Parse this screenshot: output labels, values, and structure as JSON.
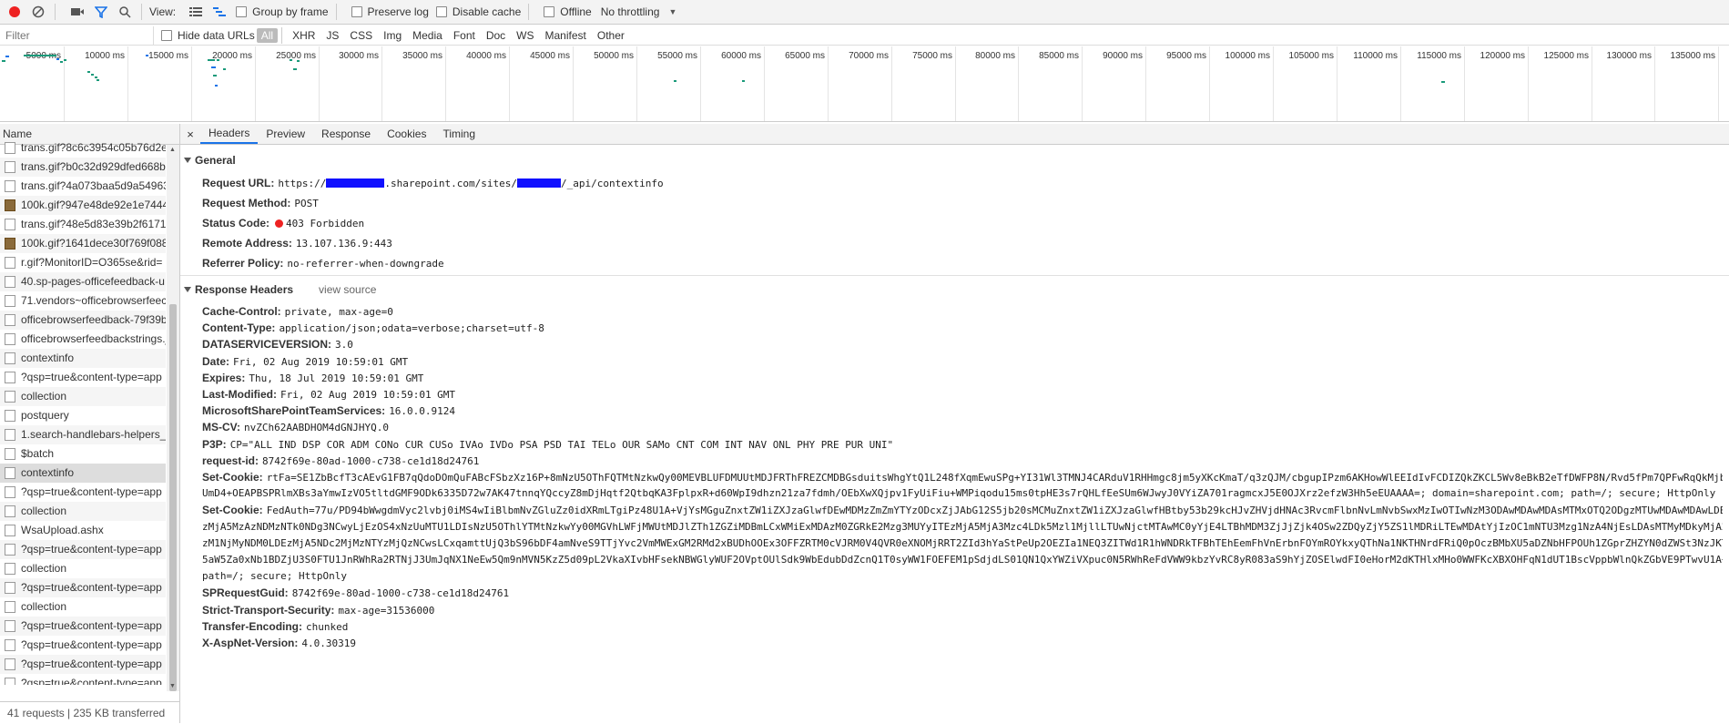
{
  "toolbar": {
    "view_label": "View:",
    "group_by_frame": "Group by frame",
    "preserve_log": "Preserve log",
    "disable_cache": "Disable cache",
    "offline": "Offline",
    "throttling": "No throttling"
  },
  "filterbar": {
    "placeholder": "Filter",
    "hide_data_urls": "Hide data URLs",
    "types": [
      "All",
      "XHR",
      "JS",
      "CSS",
      "Img",
      "Media",
      "Font",
      "Doc",
      "WS",
      "Manifest",
      "Other"
    ]
  },
  "timeline": {
    "ticks": [
      "5000 ms",
      "10000 ms",
      "15000 ms",
      "20000 ms",
      "25000 ms",
      "30000 ms",
      "35000 ms",
      "40000 ms",
      "45000 ms",
      "50000 ms",
      "55000 ms",
      "60000 ms",
      "65000 ms",
      "70000 ms",
      "75000 ms",
      "80000 ms",
      "85000 ms",
      "90000 ms",
      "95000 ms",
      "100000 ms",
      "105000 ms",
      "110000 ms",
      "115000 ms",
      "120000 ms",
      "125000 ms",
      "130000 ms",
      "135000 ms"
    ]
  },
  "name_panel": {
    "header": "Name",
    "rows": [
      "trans.gif?8c6c3954c05b76d2e",
      "trans.gif?b0c32d929dfed668b",
      "trans.gif?4a073baa5d9a54963",
      "100k.gif?947e48de92e1e7444",
      "trans.gif?48e5d83e39b2f61714",
      "100k.gif?1641dece30f769f088",
      "r.gif?MonitorID=O365se&rid=",
      "40.sp-pages-officefeedback-u",
      "71.vendors~officebrowserfeec",
      "officebrowserfeedback-79f39b",
      "officebrowserfeedbackstrings.j",
      "contextinfo",
      "?qsp=true&content-type=app",
      "collection",
      "postquery",
      "1.search-handlebars-helpers_3",
      "$batch",
      "contextinfo",
      "?qsp=true&content-type=app",
      "collection",
      "WsaUpload.ashx",
      "?qsp=true&content-type=app",
      "collection",
      "?qsp=true&content-type=app",
      "collection",
      "?qsp=true&content-type=app",
      "?qsp=true&content-type=app",
      "?qsp=true&content-type=app",
      "?qsp=true&content-type=app"
    ],
    "status": "41 requests  |  235 KB transferred"
  },
  "detail": {
    "close": "×",
    "tabs": [
      "Headers",
      "Preview",
      "Response",
      "Cookies",
      "Timing"
    ],
    "general_title": "General",
    "general": [
      {
        "k": "Request URL:",
        "v1": "https://",
        "v2": ".sharepoint.com/sites/",
        "v3": "/_api/contextinfo"
      },
      {
        "k": "Request Method:",
        "v": "POST"
      },
      {
        "k": "Status Code:",
        "v": "403 Forbidden"
      },
      {
        "k": "Remote Address:",
        "v": "13.107.136.9:443"
      },
      {
        "k": "Referrer Policy:",
        "v": "no-referrer-when-downgrade"
      }
    ],
    "response_title": "Response Headers",
    "view_source": "view source",
    "response": [
      {
        "k": "Cache-Control:",
        "v": "private, max-age=0"
      },
      {
        "k": "Content-Type:",
        "v": "application/json;odata=verbose;charset=utf-8"
      },
      {
        "k": "DATASERVICEVERSION:",
        "v": "3.0"
      },
      {
        "k": "Date:",
        "v": "Fri, 02 Aug 2019 10:59:01 GMT"
      },
      {
        "k": "Expires:",
        "v": "Thu, 18 Jul 2019 10:59:01 GMT"
      },
      {
        "k": "Last-Modified:",
        "v": "Fri, 02 Aug 2019 10:59:01 GMT"
      },
      {
        "k": "MicrosoftSharePointTeamServices:",
        "v": "16.0.0.9124"
      },
      {
        "k": "MS-CV:",
        "v": "nvZCh62AABDHOM4dGNJHYQ.0"
      },
      {
        "k": "P3P:",
        "v": "CP=\"ALL IND DSP COR ADM CONo CUR CUSo IVAo IVDo PSA PSD TAI TELo OUR SAMo CNT COM INT NAV ONL PHY PRE PUR UNI\""
      },
      {
        "k": "request-id:",
        "v": "8742f69e-80ad-1000-c738-ce1d18d24761"
      },
      {
        "k": "Set-Cookie:",
        "v": "rtFa=SE1ZbBcfT3cAEvG1FB7qQdoDOmQuFABcFSbzXz16P+8mNzU5OThFQTMtNzkwQy00MEVBLUFDMUUtMDJFRThFREZCMDBGsduitsWhgYtQ1L248fXqmEwuSPg+YI31Wl3TMNJ4CARduV1RHHmgc8jm5yXKcKmaT/q3zQJM/cbgupIPzm6AKHowWlEEIdIvFCDIZQkZKCL5Wv8eBkB2eTfDWFP8N/Rvd5fPm7QPFwRqQkMjbo"
      },
      {
        "k": "",
        "v": "UmD4+OEAPBSPRlmXBs3aYmwIzVO5tltdGMF9ODk6335D72w7AK47tnnqYQccyZ8mDjHqtf2QtbqKA3FplpxR+d60WpI9dhzn21za7fdmh/OEbXwXQjpv1FyUiFiu+WMPiqodu15ms0tpHE3s7rQHLfEeSUm6WJwyJ0VYiZA701ragmcxJ5E0OJXrz2efzW3Hh5eEUAAAA=; domain=sharepoint.com; path=/; secure; HttpOnly"
      },
      {
        "k": "Set-Cookie:",
        "v": "FedAuth=77u/PD94bWwgdmVyc2lvbj0iMS4wIiBlbmNvZGluZz0idXRmLTgiPz48U1A+VjYsMGguZnxtZW1iZXJzaGlwfDEwMDMzZmZmYTYzODcxZjJAbG12S5jb20sMCMuZnxtZW1iZXJzaGlwfHBtby53b29kcHJvZHVjdHNAc3RvcmFlbnNvLmNvbSwxMzIwOTIwNzM3ODAwMDAwMDAsMTMxOTQ2ODgzMTUwMDAwMDAwLDE"
      },
      {
        "k": "",
        "v": "zMjA5MzAzNDMzNTk0NDg3NCwyLjEzOS4xNzUuMTU1LDIsNzU5OThlYTMtNzkwYy00MGVhLWFjMWUtMDJlZTh1ZGZiMDBmLCxWMiExMDAzM0ZGRkE2Mzg3MUYyITEzMjA5MjA3Mzc4LDk5Mzl1MjllLTUwNjctMTAwMC0yYjE4LTBhMDM3ZjJjZjk4OSw2ZDQyZjY5ZS1lMDRiLTEwMDAtYjIzOC1mNTU3Mzg1NzA4NjEsLDAsMTMyMDkyMjA2"
      },
      {
        "k": "",
        "v": "zM1NjMyNDM0LDEzMjA5NDc2MjMzNTYzMjQzNCwsLCxqamttUjQ3bS96bDF4amNveS9TTjYvc2VmMWExGM2RMd2xBUDhOOEx3OFFZRTM0cVJRM0V4QVR0eXNOMjRRT2ZId3hYaStPeUp2OEZIa1NEQ3ZITWd1R1hWNDRkTFBhTEhEemFhVnErbnFOYmROYkxyQThNa1NKTHNrdFRiQ0pOczBMbXU5aDZNbHFPOUh1ZGprZHZYN0dZWSt3NzJKTDZ"
      },
      {
        "k": "",
        "v": "5aW5Za0xNb1BDZjU3S0FTU1JnRWhRa2RTNjJ3UmJqNX1NeEw5Qm9nMVN5KzZ5d09pL2VkaXIvbHFsekNBWGlyWUF2OVptOUlSdk9WbEdubDdZcnQ1T0syWW1FOEFEM1pSdjdLS01QN1QxYWZiVXpuc0N5RWhReFdVWW9kbzYvRC8yR083aS9hYjZOSElwdFI0eHorM2dKTHlxMHo0WWFKcXBXOHFqN1dUT1BscVppbWlnQkZGbVE9PTwvU1A+;"
      },
      {
        "k": "",
        "v": "path=/; secure; HttpOnly"
      },
      {
        "k": "SPRequestGuid:",
        "v": "8742f69e-80ad-1000-c738-ce1d18d24761"
      },
      {
        "k": "Strict-Transport-Security:",
        "v": "max-age=31536000"
      },
      {
        "k": "Transfer-Encoding:",
        "v": "chunked"
      },
      {
        "k": "X-AspNet-Version:",
        "v": "4.0.30319"
      }
    ]
  },
  "colors": {
    "accent": "#1a73e8",
    "record": "#e22222",
    "redaction": "#1010ff",
    "bar": "#1a9a7a"
  }
}
